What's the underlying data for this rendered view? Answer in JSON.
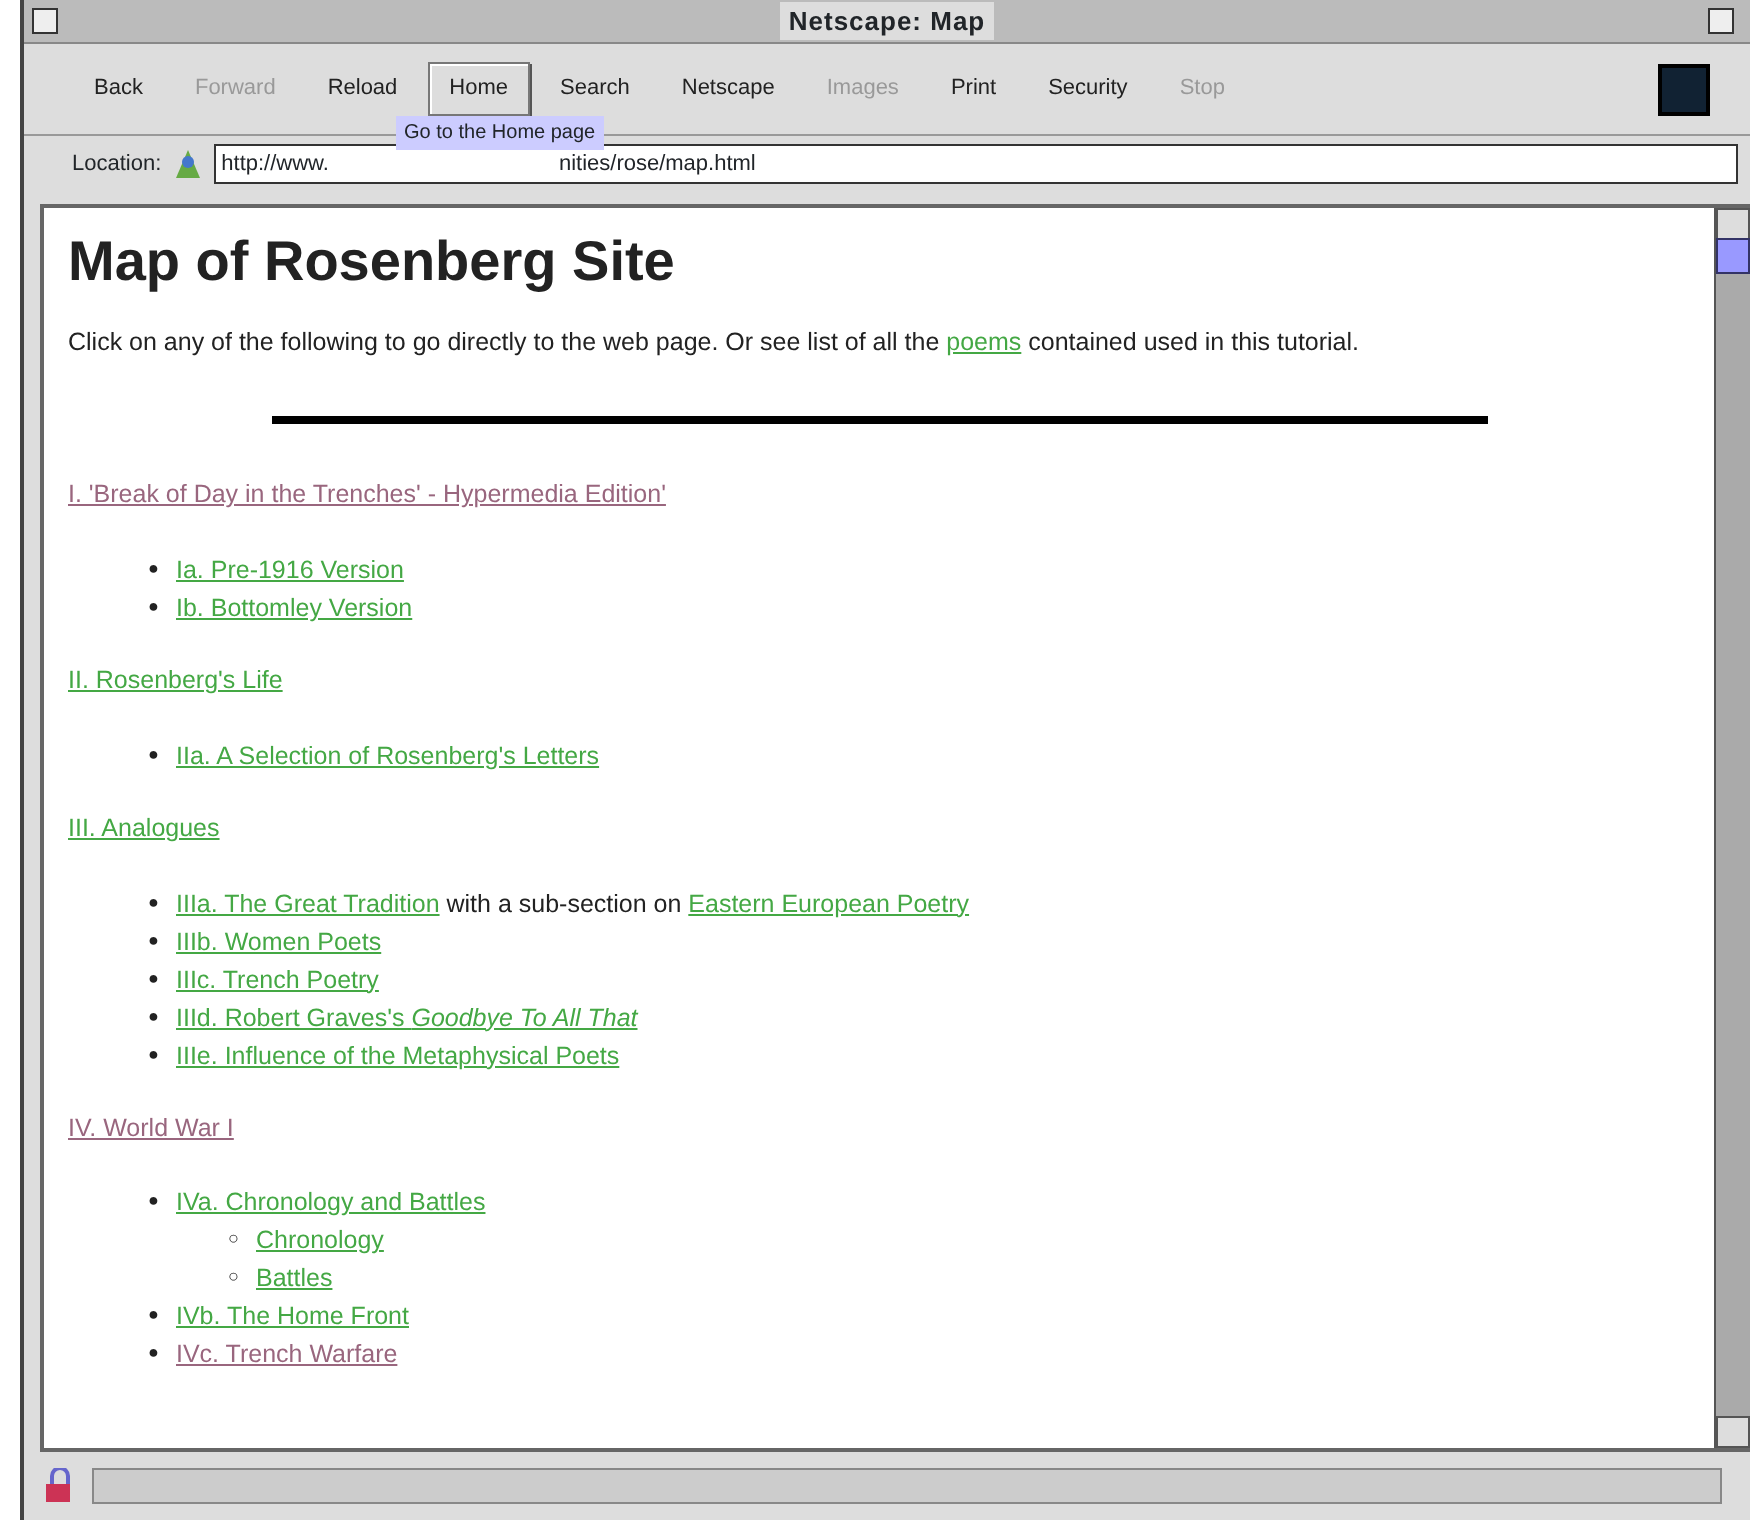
{
  "window": {
    "title": "Netscape: Map"
  },
  "toolbar": [
    {
      "label": "Back",
      "disabled": false,
      "selected": false
    },
    {
      "label": "Forward",
      "disabled": true,
      "selected": false
    },
    {
      "label": "Reload",
      "disabled": false,
      "selected": false
    },
    {
      "label": "Home",
      "disabled": false,
      "selected": true
    },
    {
      "label": "Search",
      "disabled": false,
      "selected": false
    },
    {
      "label": "Netscape",
      "disabled": false,
      "selected": false
    },
    {
      "label": "Images",
      "disabled": true,
      "selected": false
    },
    {
      "label": "Print",
      "disabled": false,
      "selected": false
    },
    {
      "label": "Security",
      "disabled": false,
      "selected": false
    },
    {
      "label": "Stop",
      "disabled": true,
      "selected": false
    }
  ],
  "tooltip": "Go to the Home page",
  "location": {
    "label": "Location:",
    "url_start": "http://www.",
    "url_end": "nities/rose/map.html"
  },
  "page": {
    "heading": "Map of Rosenberg Site",
    "intro": [
      {
        "kind": "text",
        "text": "Click on any of the following to go directly to the web page. Or see list of all the "
      },
      {
        "kind": "link",
        "text": "poems",
        "visited": false
      },
      {
        "kind": "text",
        "text": " contained used in this tutorial."
      }
    ],
    "sections": [
      {
        "title": "I. 'Break of Day in the Trenches' - Hypermedia Edition'",
        "visited": true,
        "items": [
          {
            "marker": "●",
            "parts": [
              {
                "kind": "link",
                "text": "Ia. Pre-1916 Version",
                "visited": false
              }
            ]
          },
          {
            "marker": "●",
            "parts": [
              {
                "kind": "link",
                "text": "Ib. Bottomley Version",
                "visited": false
              }
            ]
          }
        ]
      },
      {
        "title": "II. Rosenberg's Life",
        "visited": false,
        "items": [
          {
            "marker": "●",
            "parts": [
              {
                "kind": "link",
                "text": "IIa. A Selection of Rosenberg's Letters",
                "visited": false
              }
            ]
          }
        ]
      },
      {
        "title": "III. Analogues",
        "visited": false,
        "items": [
          {
            "marker": "●",
            "parts": [
              {
                "kind": "link",
                "text": "IIIa. The Great Tradition",
                "visited": false
              },
              {
                "kind": "text",
                "text": " with a sub-section on "
              },
              {
                "kind": "link",
                "text": "Eastern European Poetry",
                "visited": false
              }
            ]
          },
          {
            "marker": "●",
            "parts": [
              {
                "kind": "link",
                "text": "IIIb. Women Poets",
                "visited": false
              }
            ]
          },
          {
            "marker": "●",
            "parts": [
              {
                "kind": "link",
                "text": "IIIc. Trench Poetry",
                "visited": false
              }
            ]
          },
          {
            "marker": "●",
            "parts": [
              {
                "kind": "link",
                "text": "IIId. Robert Graves's *Goodbye To All That*",
                "visited": false
              }
            ]
          },
          {
            "marker": "●",
            "parts": [
              {
                "kind": "link",
                "text": "IIIe. Influence of the Metaphysical Poets",
                "visited": false
              }
            ]
          }
        ]
      },
      {
        "title": "IV. World War I",
        "visited": true,
        "items": [
          {
            "marker": "●",
            "parts": [
              {
                "kind": "link",
                "text": "IVa. Chronology and Battles",
                "visited": false
              }
            ],
            "children": [
              {
                "marker": "○",
                "parts": [
                  {
                    "kind": "link",
                    "text": "Chronology",
                    "visited": false
                  }
                ]
              },
              {
                "marker": "○",
                "parts": [
                  {
                    "kind": "link",
                    "text": "Battles",
                    "visited": false
                  }
                ]
              }
            ]
          },
          {
            "marker": "●",
            "parts": [
              {
                "kind": "link",
                "text": "IVb. The Home Front",
                "visited": false
              }
            ]
          },
          {
            "marker": "●",
            "parts": [
              {
                "kind": "link",
                "text": "IVc. Trench Warfare",
                "visited": true
              }
            ]
          }
        ]
      }
    ]
  }
}
